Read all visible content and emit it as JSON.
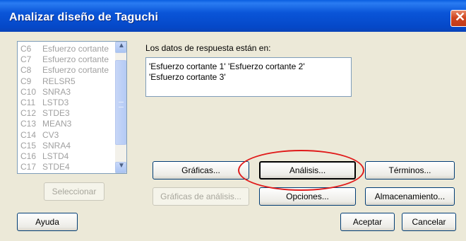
{
  "window": {
    "title": "Analizar diseño de Taguchi",
    "close_symbol": "✕"
  },
  "columns_list": {
    "items": [
      {
        "col": "C6",
        "name": "Esfuerzo cortante"
      },
      {
        "col": "C7",
        "name": "Esfuerzo cortante"
      },
      {
        "col": "C8",
        "name": "Esfuerzo cortante"
      },
      {
        "col": "C9",
        "name": "RELSR5"
      },
      {
        "col": "C10",
        "name": "SNRA3"
      },
      {
        "col": "C11",
        "name": "LSTD3"
      },
      {
        "col": "C12",
        "name": "STDE3"
      },
      {
        "col": "C13",
        "name": "MEAN3"
      },
      {
        "col": "C14",
        "name": "CV3"
      },
      {
        "col": "C15",
        "name": "SNRA4"
      },
      {
        "col": "C16",
        "name": "LSTD4"
      },
      {
        "col": "C17",
        "name": "STDE4"
      }
    ],
    "scroll_up_symbol": "▲",
    "scroll_down_symbol": "▼"
  },
  "response": {
    "label": "Los datos de respuesta están en:",
    "line1": "'Esfuerzo cortante 1' 'Esfuerzo cortante 2'",
    "line2": "'Esfuerzo cortante 3'"
  },
  "buttons": {
    "select": "Seleccionar",
    "graphs": "Gráficas...",
    "analysis": "Análisis...",
    "terms": "Términos...",
    "analysis_graphs": "Gráficas de análisis...",
    "options": "Opciones...",
    "storage": "Almacenamiento...",
    "help": "Ayuda",
    "ok": "Aceptar",
    "cancel": "Cancelar"
  },
  "annotation_color": "#e01a1a"
}
